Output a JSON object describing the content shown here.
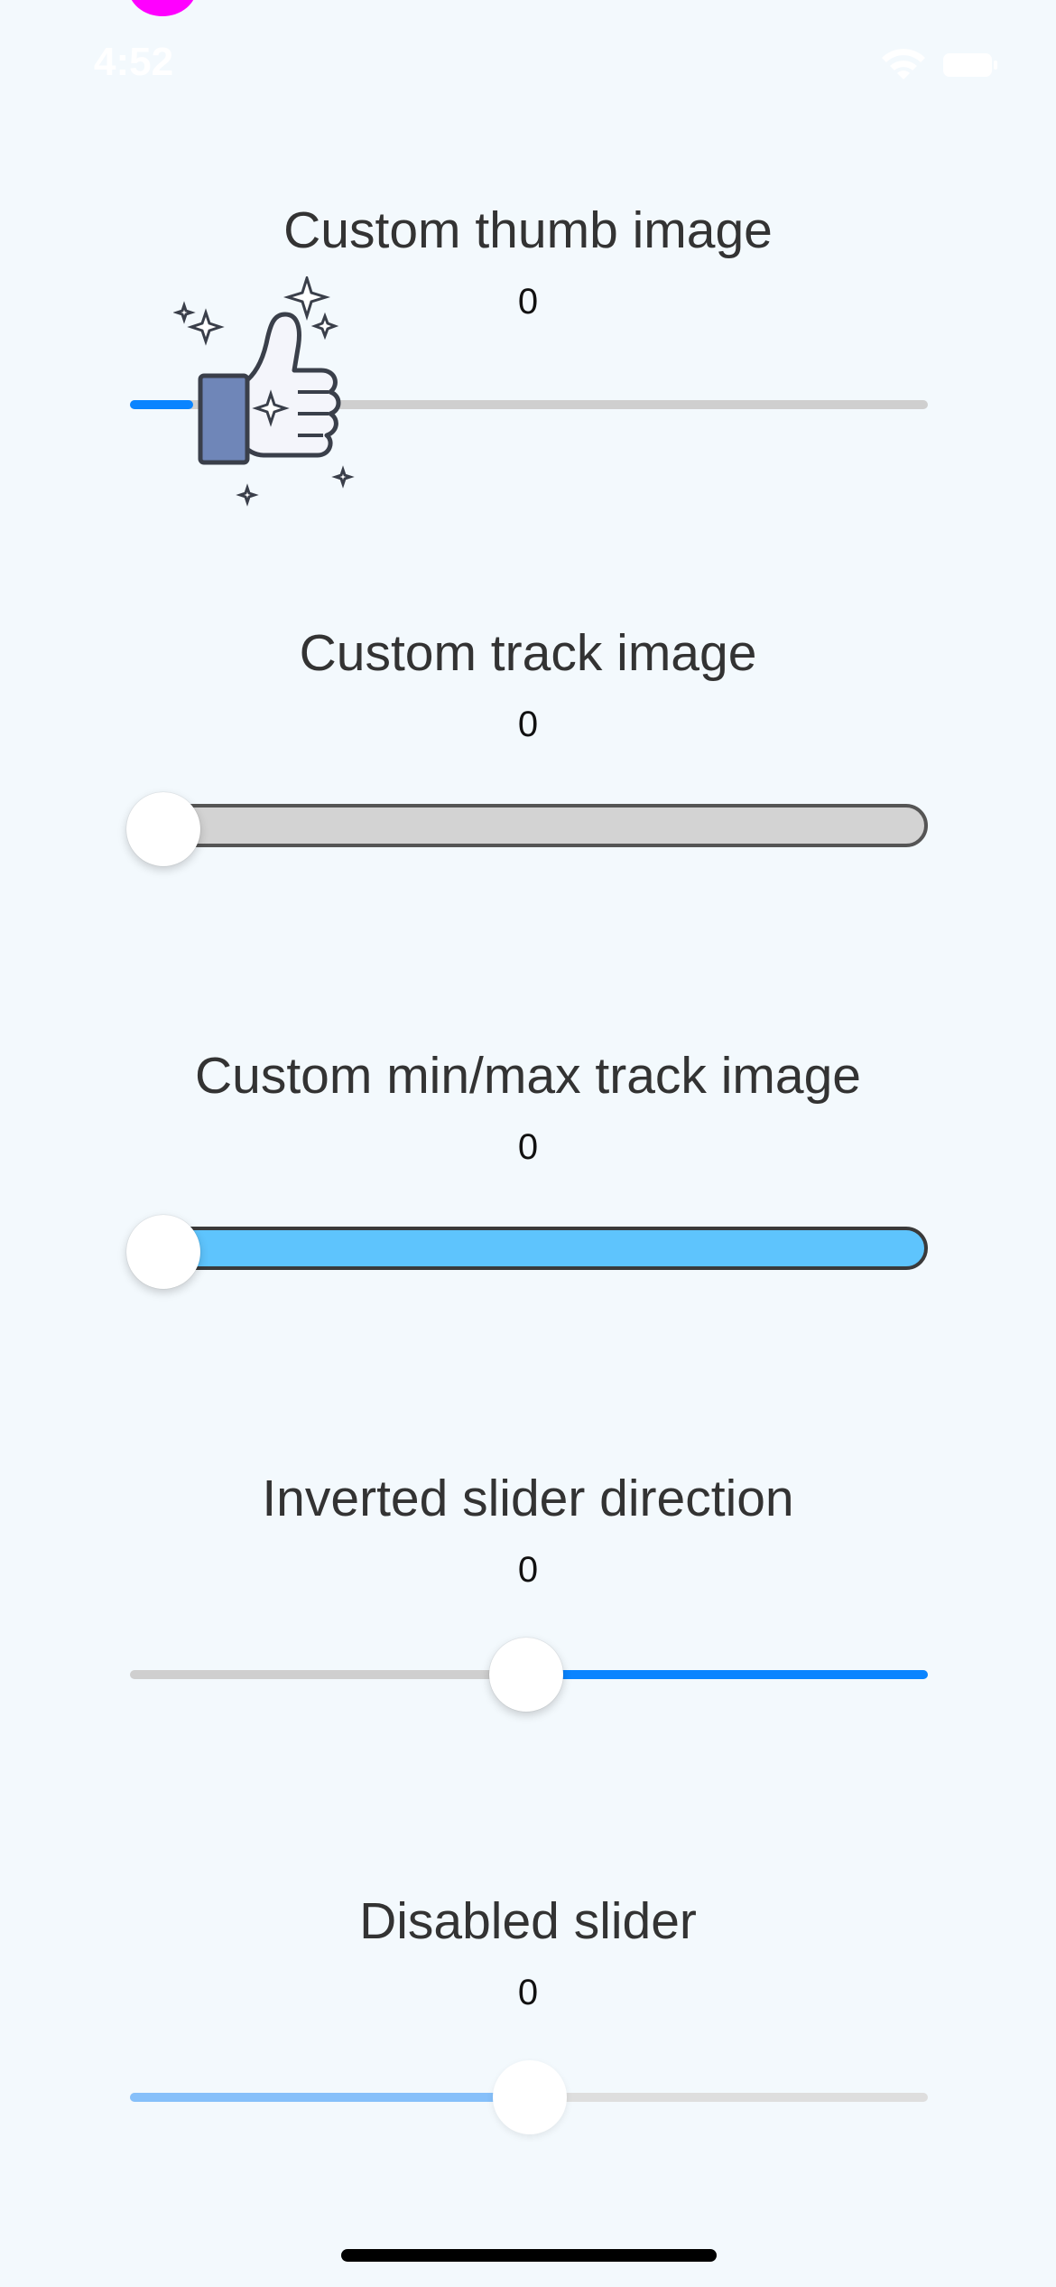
{
  "status_bar": {
    "time": "4:52",
    "wifi_icon": "wifi-icon",
    "battery_icon": "battery-icon"
  },
  "sections": [
    {
      "title": "Custom thumb image",
      "value": "0",
      "slider_level": 0.0,
      "thumb_icon": "thumbs-up-icon",
      "colors": {
        "min_track": "#0a84ff",
        "max_track": "#cfcfcf"
      }
    },
    {
      "title": "Custom track image",
      "value": "0",
      "slider_level": 0.0,
      "colors": {
        "track": "#d3d3d3",
        "border": "#555555"
      }
    },
    {
      "title": "Custom min/max track image",
      "value": "0",
      "slider_level": 0.0,
      "colors": {
        "track": "#5ec4fd",
        "border": "#3a3a3a"
      }
    },
    {
      "title": "Inverted slider direction",
      "value": "0",
      "slider_level": 0.5,
      "colors": {
        "min_track": "#cfcfcf",
        "max_track": "#0a84ff"
      }
    },
    {
      "title": "Disabled slider",
      "value": "0",
      "slider_level": 0.5,
      "colors": {
        "min_track": "#86c0fa",
        "max_track": "#dedede"
      }
    }
  ]
}
